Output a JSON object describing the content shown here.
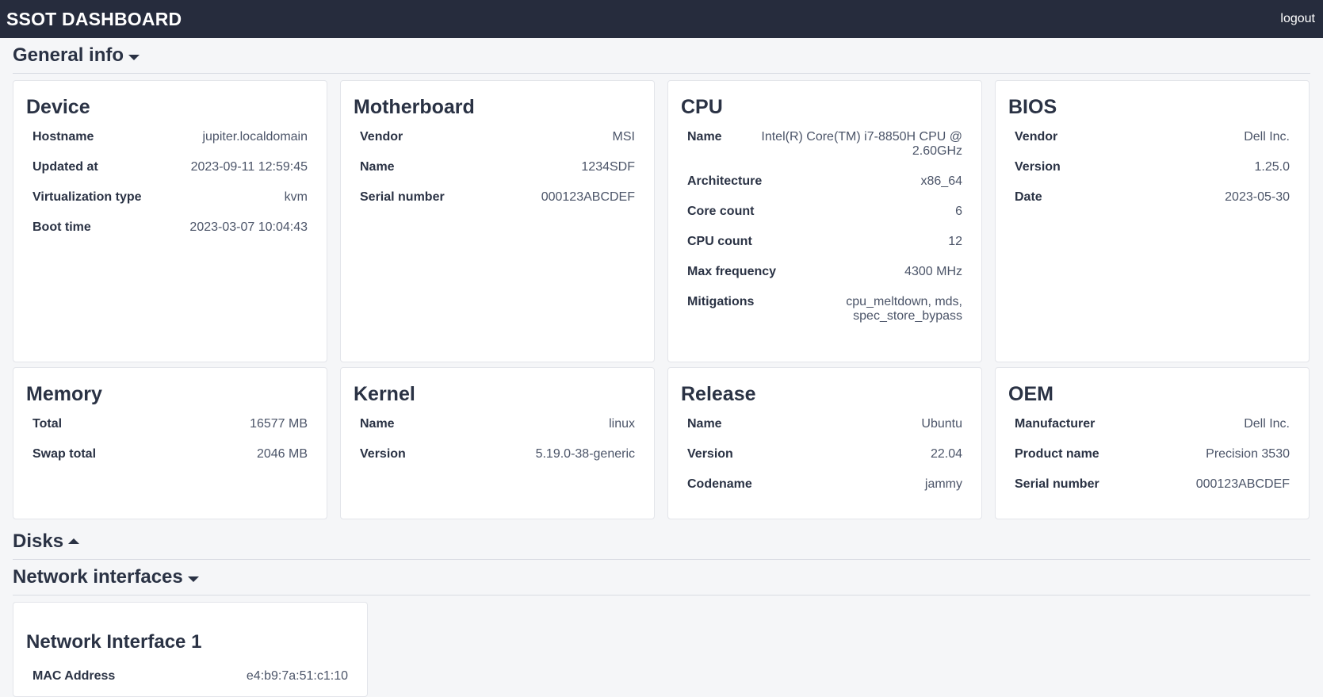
{
  "app": {
    "title": "SSOT DASHBOARD",
    "logout": "logout"
  },
  "sections": {
    "general": "General info",
    "disks": "Disks",
    "network": "Network interfaces"
  },
  "cards": {
    "device": {
      "title": "Device",
      "rows": [
        {
          "k": "Hostname",
          "v": "jupiter.localdomain"
        },
        {
          "k": "Updated at",
          "v": "2023-09-11 12:59:45"
        },
        {
          "k": "Virtualization type",
          "v": "kvm"
        },
        {
          "k": "Boot time",
          "v": "2023-03-07 10:04:43"
        }
      ]
    },
    "motherboard": {
      "title": "Motherboard",
      "rows": [
        {
          "k": "Vendor",
          "v": "MSI"
        },
        {
          "k": "Name",
          "v": "1234SDF"
        },
        {
          "k": "Serial number",
          "v": "000123ABCDEF"
        }
      ]
    },
    "cpu": {
      "title": "CPU",
      "rows": [
        {
          "k": "Name",
          "v": "Intel(R) Core(TM) i7-8850H CPU @ 2.60GHz"
        },
        {
          "k": "Architecture",
          "v": "x86_64"
        },
        {
          "k": "Core count",
          "v": "6"
        },
        {
          "k": "CPU count",
          "v": "12"
        },
        {
          "k": "Max frequency",
          "v": "4300 MHz"
        },
        {
          "k": "Mitigations",
          "v": "cpu_meltdown, mds, spec_store_bypass"
        }
      ]
    },
    "bios": {
      "title": "BIOS",
      "rows": [
        {
          "k": "Vendor",
          "v": "Dell Inc."
        },
        {
          "k": "Version",
          "v": "1.25.0"
        },
        {
          "k": "Date",
          "v": "2023-05-30"
        }
      ]
    },
    "memory": {
      "title": "Memory",
      "rows": [
        {
          "k": "Total",
          "v": "16577 MB"
        },
        {
          "k": "Swap total",
          "v": "2046 MB"
        }
      ]
    },
    "kernel": {
      "title": "Kernel",
      "rows": [
        {
          "k": "Name",
          "v": "linux"
        },
        {
          "k": "Version",
          "v": "5.19.0-38-generic"
        }
      ]
    },
    "release": {
      "title": "Release",
      "rows": [
        {
          "k": "Name",
          "v": "Ubuntu"
        },
        {
          "k": "Version",
          "v": "22.04"
        },
        {
          "k": "Codename",
          "v": "jammy"
        }
      ]
    },
    "oem": {
      "title": "OEM",
      "rows": [
        {
          "k": "Manufacturer",
          "v": "Dell Inc."
        },
        {
          "k": "Product name",
          "v": "Precision 3530"
        },
        {
          "k": "Serial number",
          "v": "000123ABCDEF"
        }
      ]
    },
    "net1": {
      "title": "Network Interface 1",
      "rows": [
        {
          "k": "MAC Address",
          "v": "e4:b9:7a:51:c1:10"
        }
      ]
    }
  }
}
